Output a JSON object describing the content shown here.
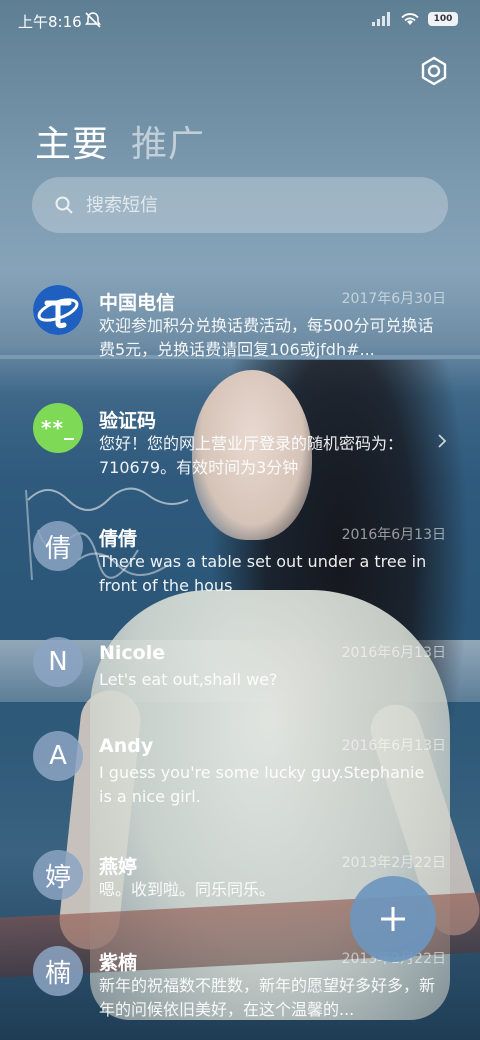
{
  "status_bar": {
    "time": "上午8:16",
    "mute_icon": "bell-off-icon",
    "signal_icon": "signal-icon",
    "wifi_icon": "wifi-icon",
    "battery_level": "100"
  },
  "header": {
    "settings_icon": "gear-icon",
    "tabs": [
      {
        "label": "主要",
        "active": true
      },
      {
        "label": "推广",
        "active": false
      }
    ]
  },
  "search": {
    "placeholder": "搜索短信",
    "icon": "search-icon"
  },
  "conversations": [
    {
      "name": "中国电信",
      "date": "2017年6月30日",
      "preview": "欢迎参加积分兑换话费活动，每500分可兑换话费5元，兑换话费请回复106或jfdh#...",
      "avatar": "telecom-logo"
    },
    {
      "name": "验证码",
      "date": "",
      "preview": "您好！您的网上营业厅登录的随机密码为：710679。有效时间为3分钟",
      "avatar_text": "**_"
    },
    {
      "name": "倩倩",
      "date": "2016年6月13日",
      "preview": "There was a table set out under a tree in front of the hous",
      "avatar_text": "倩"
    },
    {
      "name": "Nicole",
      "date": "2016年6月13日",
      "preview": "Let's eat out,shall we?",
      "avatar_text": "N"
    },
    {
      "name": "Andy",
      "date": "2016年6月13日",
      "preview": "I guess you're some lucky guy.Stephanie is a nice girl.",
      "avatar_text": "A"
    },
    {
      "name": "燕婷",
      "date": "2013年2月22日",
      "preview": "嗯。收到啦。同乐同乐。",
      "avatar_text": "婷"
    },
    {
      "name": "紫楠",
      "date": "2013年2月22日",
      "preview": "新年的祝福数不胜数，新年的愿望好多好多，新年的问候依旧美好，在这个温馨的...",
      "avatar_text": "楠"
    }
  ],
  "fab": {
    "icon": "plus-icon"
  },
  "colors": {
    "fab": "#6e96be",
    "verify_avatar": "#7ed957",
    "contact_avatar": "#8ca5c3"
  }
}
